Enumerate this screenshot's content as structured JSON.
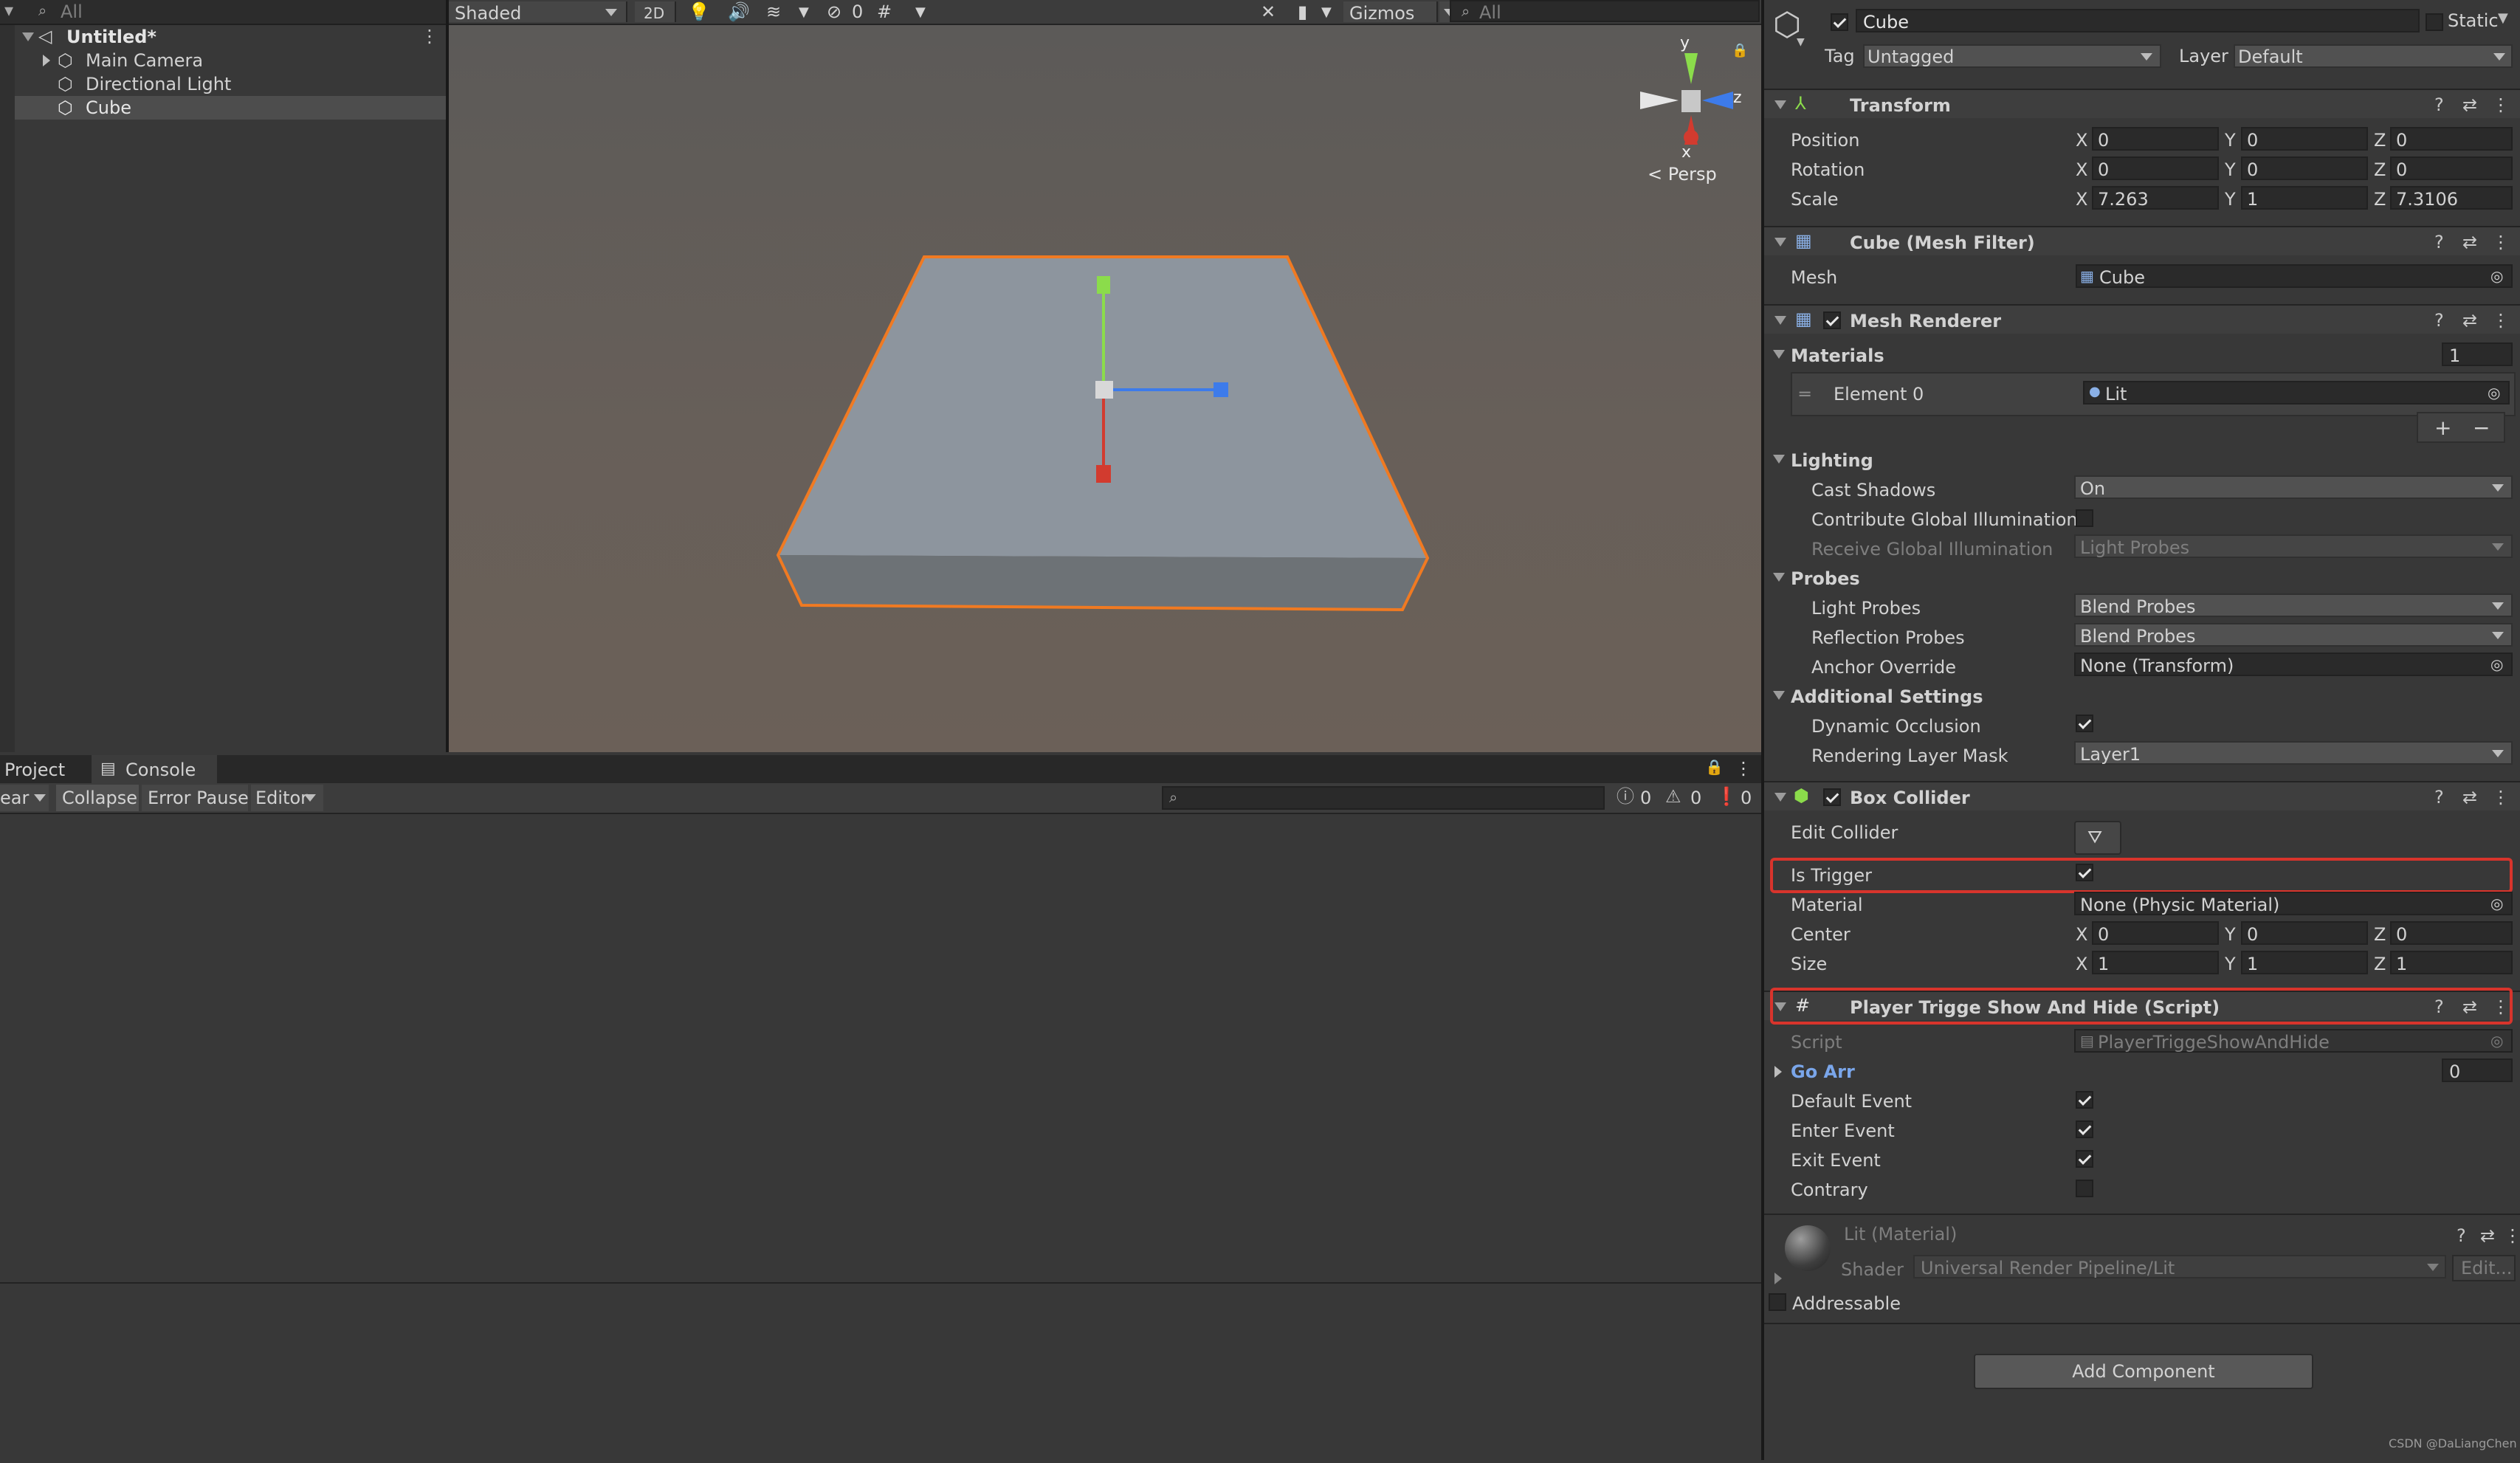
{
  "hierarchy": {
    "search_placeholder": "All",
    "scene_name": "Untitled*",
    "items": [
      {
        "label": "Main Camera"
      },
      {
        "label": "Directional Light"
      },
      {
        "label": "Cube"
      }
    ]
  },
  "scene_toolbar": {
    "shading_mode": "Shaded",
    "mode_2d": "2D",
    "hidden_count": "0",
    "gizmos_label": "Gizmos",
    "search_placeholder": "All",
    "persp_label": "Persp",
    "axis_x": "x",
    "axis_y": "y",
    "axis_z": "z"
  },
  "console": {
    "tabs": [
      {
        "label": "Project"
      },
      {
        "label": "Console"
      }
    ],
    "clear_label": "ear",
    "collapse_label": "Collapse",
    "error_pause_label": "Error Pause",
    "editor_label": "Editor",
    "info_count": "0",
    "warn_count": "0",
    "error_count": "0"
  },
  "inspector": {
    "object_name": "Cube",
    "static_label": "Static",
    "tag_label": "Tag",
    "tag_value": "Untagged",
    "layer_label": "Layer",
    "layer_value": "Default",
    "transform": {
      "title": "Transform",
      "position_label": "Position",
      "position": {
        "x": "0",
        "y": "0",
        "z": "0"
      },
      "rotation_label": "Rotation",
      "rotation": {
        "x": "0",
        "y": "0",
        "z": "0"
      },
      "scale_label": "Scale",
      "scale": {
        "x": "7.263",
        "y": "1",
        "z": "7.3106"
      },
      "x": "X",
      "y": "Y",
      "z": "Z"
    },
    "mesh_filter": {
      "title": "Cube (Mesh Filter)",
      "mesh_label": "Mesh",
      "mesh_value": "Cube"
    },
    "mesh_renderer": {
      "title": "Mesh Renderer",
      "materials_label": "Materials",
      "materials_count": "1",
      "element0_label": "Element 0",
      "element0_value": "Lit",
      "lighting_label": "Lighting",
      "cast_shadows_label": "Cast Shadows",
      "cast_shadows_value": "On",
      "contribute_gi_label": "Contribute Global Illumination",
      "receive_gi_label": "Receive Global Illumination",
      "receive_gi_value": "Light Probes",
      "probes_label": "Probes",
      "light_probes_label": "Light Probes",
      "light_probes_value": "Blend Probes",
      "reflection_probes_label": "Reflection Probes",
      "reflection_probes_value": "Blend Probes",
      "anchor_override_label": "Anchor Override",
      "anchor_override_value": "None (Transform)",
      "additional_settings_label": "Additional Settings",
      "dynamic_occlusion_label": "Dynamic Occlusion",
      "rendering_layer_mask_label": "Rendering Layer Mask",
      "rendering_layer_mask_value": "Layer1"
    },
    "box_collider": {
      "title": "Box Collider",
      "edit_collider_label": "Edit Collider",
      "is_trigger_label": "Is Trigger",
      "material_label": "Material",
      "material_value": "None (Physic Material)",
      "center_label": "Center",
      "center": {
        "x": "0",
        "y": "0",
        "z": "0"
      },
      "size_label": "Size",
      "size": {
        "x": "1",
        "y": "1",
        "z": "1"
      }
    },
    "script_component": {
      "title": "Player Trigge Show And Hide (Script)",
      "script_label": "Script",
      "script_value": "PlayerTriggeShowAndHide",
      "go_arr_label": "Go Arr",
      "go_arr_count": "0",
      "default_event_label": "Default Event",
      "enter_event_label": "Enter Event",
      "exit_event_label": "Exit Event",
      "contrary_label": "Contrary"
    },
    "material": {
      "title": "Lit (Material)",
      "shader_label": "Shader",
      "shader_value": "Universal Render Pipeline/Lit",
      "edit_label": "Edit..."
    },
    "addressable_label": "Addressable",
    "add_component_label": "Add Component",
    "watermark": "CSDN @DaLiangChen"
  },
  "colors": {
    "highlight": "#d8342c",
    "selection_outline": "#f07a22",
    "gizmo_x": "#d23b2f",
    "gizmo_y": "#8bdc4b",
    "gizmo_z": "#3d7bea"
  }
}
